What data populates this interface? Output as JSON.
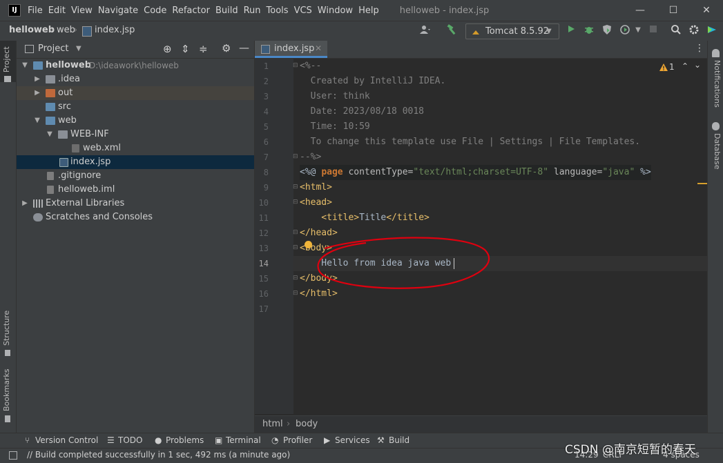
{
  "window": {
    "logo": "IJ",
    "title": "helloweb - index.jsp",
    "menu": [
      "File",
      "Edit",
      "View",
      "Navigate",
      "Code",
      "Refactor",
      "Build",
      "Run",
      "Tools",
      "VCS",
      "Window",
      "Help"
    ],
    "controls": {
      "minimize": "—",
      "maximize": "☐",
      "close": "✕"
    }
  },
  "navbar": {
    "breadcrumbs": [
      "helloweb",
      "web",
      "index.jsp"
    ],
    "run_config": "Tomcat 8.5.92"
  },
  "left_stripe": {
    "project_tab": "Project",
    "structure_tab": "Structure",
    "bookmarks_tab": "Bookmarks"
  },
  "right_stripe": {
    "notifications_tab": "Notifications",
    "database_tab": "Database"
  },
  "project_panel": {
    "title": "Project",
    "tree": [
      {
        "label": "helloweb",
        "path": "D:\\ideawork\\helloweb"
      },
      {
        "label": ".idea"
      },
      {
        "label": "out"
      },
      {
        "label": "src"
      },
      {
        "label": "web"
      },
      {
        "label": "WEB-INF"
      },
      {
        "label": "web.xml"
      },
      {
        "label": "index.jsp"
      },
      {
        "label": ".gitignore"
      },
      {
        "label": "helloweb.iml"
      },
      {
        "label": "External Libraries"
      },
      {
        "label": "Scratches and Consoles"
      }
    ]
  },
  "editor": {
    "tab_label": "index.jsp",
    "warning_count": "1",
    "line_numbers": [
      "1",
      "2",
      "3",
      "4",
      "5",
      "6",
      "7",
      "8",
      "9",
      "10",
      "11",
      "12",
      "13",
      "14",
      "15",
      "16",
      "17"
    ],
    "lines": {
      "l1": "<%--",
      "l2": "  Created by IntelliJ IDEA.",
      "l3": "  User: think",
      "l4": "  Date: 2023/08/18 0018",
      "l5": "  Time: 10:59",
      "l6": "  To change this template use File | Settings | File Templates.",
      "l7": "--%>",
      "l8_open": "<%@ ",
      "l8_page": "page",
      "l8_attr1": " contentType=",
      "l8_val1": "\"text/html;charset=UTF-8\"",
      "l8_attr2": " language=",
      "l8_val2": "\"java\"",
      "l8_close": " %>",
      "l9": "<html>",
      "l10": "<head>",
      "l11_open": "    <title>",
      "l11_text": "Title",
      "l11_close": "</title>",
      "l12": "</head>",
      "l13": "<body>",
      "l14": "    Hello from idea java web",
      "l15": "</body>",
      "l16": "</html>"
    },
    "breadcrumb": [
      "html",
      "body"
    ]
  },
  "bottom_tools": [
    "Version Control",
    "TODO",
    "Problems",
    "Terminal",
    "Profiler",
    "Services",
    "Build"
  ],
  "status": {
    "message": "// Build completed successfully in 1 sec, 492 ms (a minute ago)",
    "position": "14:29",
    "line_sep": "CRLF",
    "indent": "4 spaces",
    "watermark": "CSDN @南京短暂的春天"
  },
  "colors": {
    "accent": "#4a88c7",
    "annotation": "#e0000f",
    "keyword": "#cc7832",
    "tag": "#e8bf6a",
    "string": "#6a8759"
  }
}
